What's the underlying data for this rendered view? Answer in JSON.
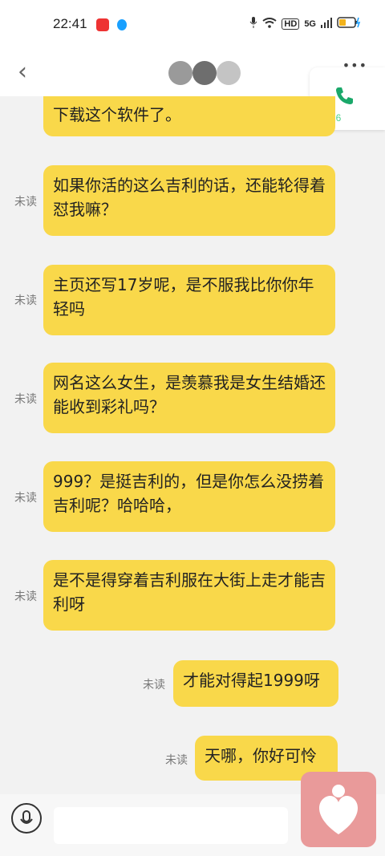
{
  "status": {
    "time": "22:41",
    "hd": "HD",
    "network": "5G"
  },
  "header": {
    "call_duration": "1:26"
  },
  "messages": [
    {
      "text": "下载这个软件了。",
      "unread": ""
    },
    {
      "text": "如果你活的这么吉利的话，还能轮得着怼我嘛？",
      "unread": "未读"
    },
    {
      "text": "主页还写17岁呢，是不服我比你你年轻吗",
      "unread": "未读"
    },
    {
      "text": "网名这么女生，是羡慕我是女生结婚还能收到彩礼吗？",
      "unread": "未读"
    },
    {
      "text": "999？是挺吉利的，但是你怎么没捞着吉利呢？哈哈哈，",
      "unread": "未读"
    },
    {
      "text": "是不是得穿着吉利服在大街上走才能吉利呀",
      "unread": "未读"
    },
    {
      "text": "才能对得起1999呀",
      "unread": "未读"
    },
    {
      "text": "天哪，你好可怜",
      "unread": "未读"
    }
  ],
  "colors": {
    "bubble": "#f9d84a",
    "call_green": "#1aa86a",
    "accent_pink": "#e99a9a"
  },
  "icons": [
    "back-arrow-icon",
    "more-icon",
    "phone-icon",
    "mic-icon",
    "heart-icon"
  ]
}
